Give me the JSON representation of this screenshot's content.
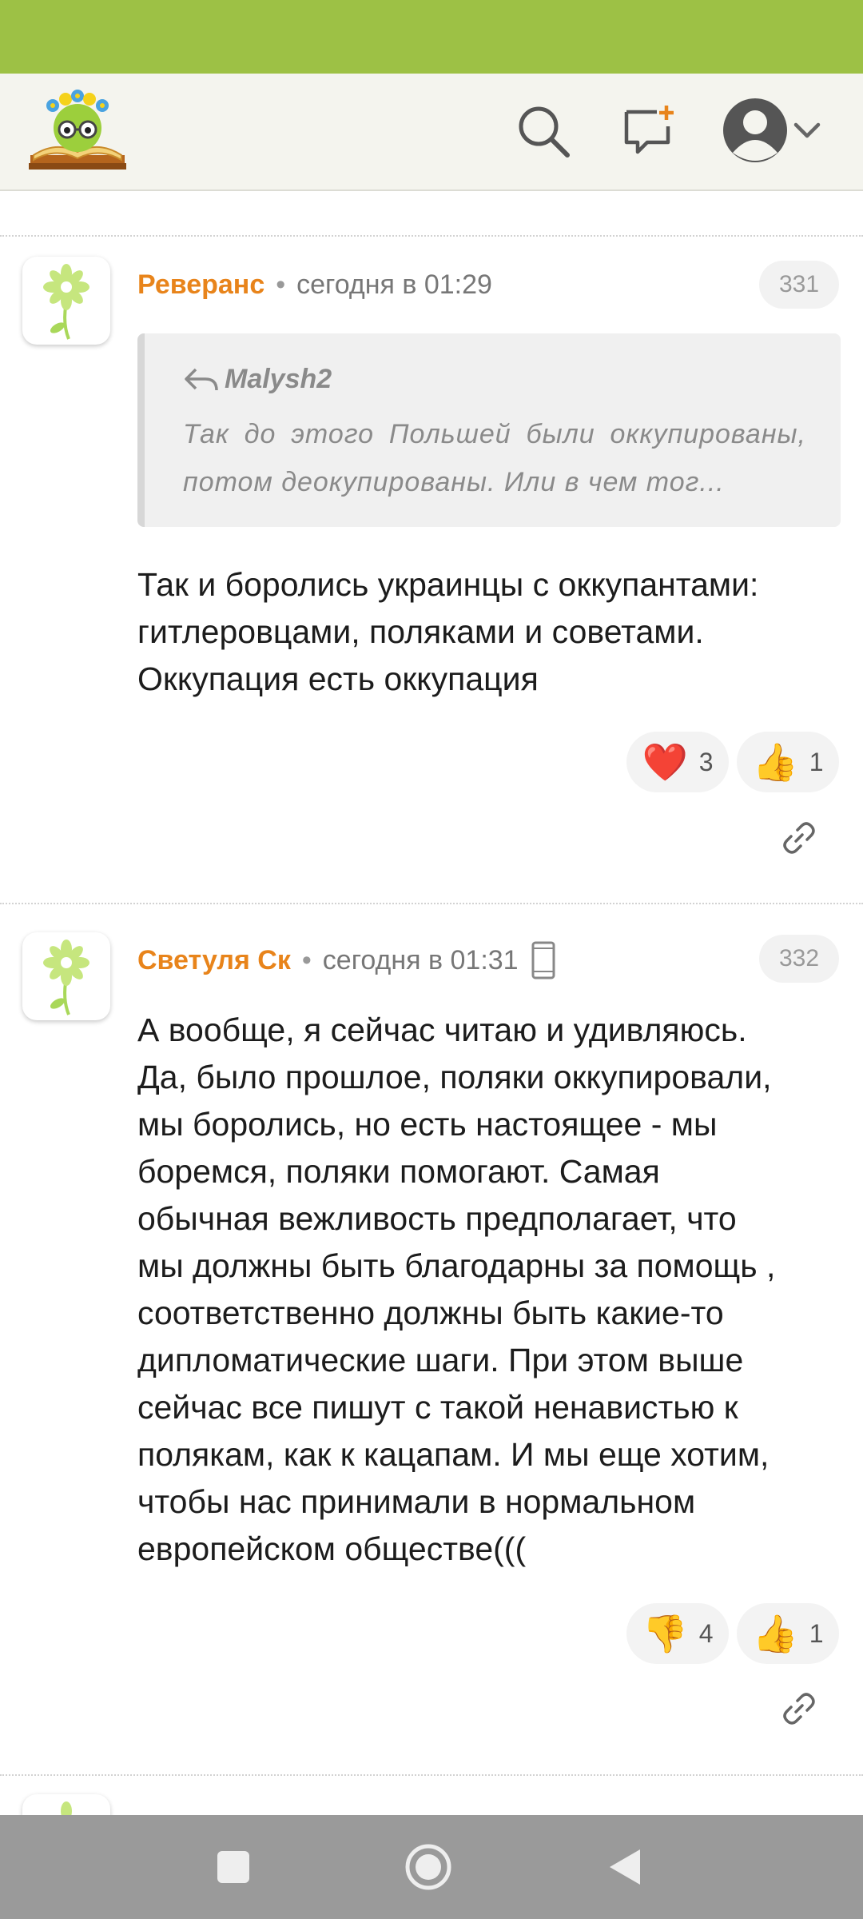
{
  "header": {
    "logo_icon": "book-flower-mascot-logo",
    "search_icon": "search-icon",
    "new_post_icon": "new-message-icon",
    "profile_icon": "user-avatar-icon",
    "dropdown_icon": "chevron-down-icon"
  },
  "comments": [
    {
      "author": "Реверанс",
      "dot": "•",
      "time": "сегодня в 01:29",
      "number": "331",
      "quote": {
        "author": "Malysh2",
        "text": "Так до этого Польшей были оккупированы, потом деокупированы. Или в чем тог..."
      },
      "body": [
        "Так и боролись украинцы с оккупантами:",
        "гитлеровцами, поляками и советами.",
        "Оккупация есть оккупация"
      ],
      "reactions": [
        {
          "emoji": "❤️",
          "icon": "heart-icon",
          "count": "3"
        },
        {
          "emoji": "👍",
          "icon": "thumbs-up-icon",
          "count": "1"
        }
      ]
    },
    {
      "author": "Светуля Ск",
      "dot": "•",
      "time": "сегодня в 01:31",
      "device_icon": "mobile-phone-icon",
      "number": "332",
      "body": [
        "А вообще, я сейчас читаю и удивляюсь.",
        "Да, было прошлое, поляки оккупировали,",
        "мы боролись, но есть настоящее - мы",
        "боремся, поляки помогают. Самая",
        "обычная вежливость предполагает, что",
        "мы должны быть благодарны за помощь ,",
        "соответственно должны быть какие-то",
        "дипломатические шаги. При этом выше",
        "сейчас все пишут с такой ненавистью к",
        "полякам, как к кацапам. И мы еще хотим,",
        "чтобы нас принимали в нормальном",
        "европейском обществе((("
      ],
      "reactions": [
        {
          "emoji": "👎",
          "icon": "thumbs-down-icon",
          "count": "4"
        },
        {
          "emoji": "👍",
          "icon": "thumbs-up-icon",
          "count": "1"
        }
      ]
    }
  ],
  "colors": {
    "status_bar": "#9dc145",
    "author": "#e8841b",
    "nav_bar": "#9a9a9a"
  },
  "nav": {
    "recents_icon": "square-recents-icon",
    "home_icon": "circle-home-icon",
    "back_icon": "triangle-back-icon"
  }
}
